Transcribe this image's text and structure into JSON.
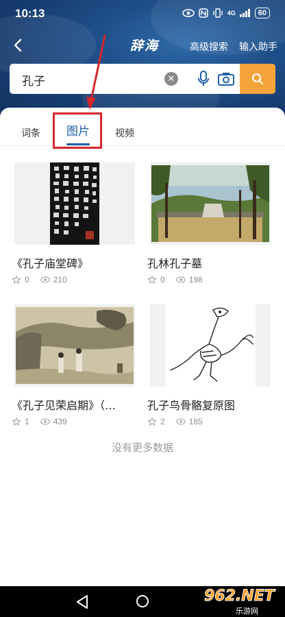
{
  "status_bar": {
    "time": "10:13",
    "network": "4G",
    "battery": "60"
  },
  "nav": {
    "logo": "辞海",
    "advanced_search": "高级搜索",
    "input_assistant": "输入助手"
  },
  "search": {
    "query": "孔子"
  },
  "tabs": [
    {
      "label": "词条"
    },
    {
      "label": "图片"
    },
    {
      "label": "视频"
    }
  ],
  "cards": [
    {
      "title": "《孔子庙堂碑》",
      "likes": "0",
      "views": "210"
    },
    {
      "title": "孔林孔子墓",
      "likes": "0",
      "views": "198"
    },
    {
      "title": "《孔子见荣启期》（…",
      "likes": "1",
      "views": "439"
    },
    {
      "title": "孔子鸟骨骼复原图",
      "likes": "2",
      "views": "185"
    }
  ],
  "no_more_text": "没有更多数据",
  "watermark": {
    "main": "962.NET",
    "sub": "乐游网"
  },
  "colors": {
    "accent": "#1f5fa8",
    "search_button": "#f5a43b",
    "annotation": "#d8262b"
  }
}
